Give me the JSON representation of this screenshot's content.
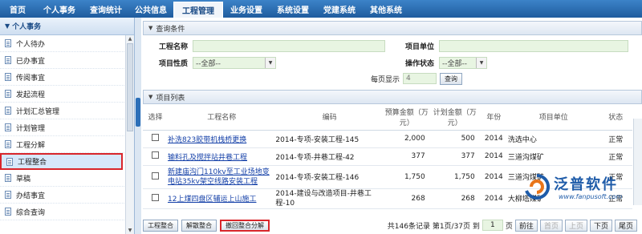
{
  "nav": {
    "items": [
      "首页",
      "个人事务",
      "查询统计",
      "公共信息",
      "工程管理",
      "业务设置",
      "系统设置",
      "党建系统",
      "其他系统"
    ],
    "active_index": 4
  },
  "sidebar": {
    "header": "个人事务",
    "items": [
      "个人待办",
      "已办事宜",
      "传阅事宜",
      "发起流程",
      "计划汇总管理",
      "计划管理",
      "工程分解",
      "工程整合",
      "草稿",
      "办结事宜",
      "综合查询"
    ],
    "selected_index": 7
  },
  "query": {
    "title": "查询条件",
    "project_name_label": "工程名称",
    "project_name_value": "",
    "project_unit_label": "项目单位",
    "project_unit_value": "",
    "project_type_label": "项目性质",
    "project_type_value": "--全部--",
    "op_status_label": "操作状态",
    "op_status_value": "--全部--",
    "per_page_label": "每页显示",
    "per_page_value": "4",
    "search_button": "查询"
  },
  "list": {
    "title": "项目列表",
    "columns": [
      "选择",
      "工程名称",
      "编码",
      "预算金额（万元）",
      "计划金额（万元）",
      "年份",
      "项目单位",
      "状态"
    ],
    "rows": [
      {
        "name": "补洗823胶带机栈桥更换",
        "code": "2014-专项-安装工程-145",
        "budget": "2,000",
        "plan": "500",
        "year": "2014",
        "unit": "洗选中心",
        "status": "正常"
      },
      {
        "name": "输料孔及搅拌站井巷工程",
        "code": "2014-专项-井巷工程-42",
        "budget": "377",
        "plan": "377",
        "year": "2014",
        "unit": "三道沟煤矿",
        "status": "正常"
      },
      {
        "name": "新建庙沟门110kv至工业场地变电站35kv架空线路安装工程",
        "code": "2014-专项-安装工程-146",
        "budget": "1,750",
        "plan": "1,750",
        "year": "2014",
        "unit": "三道沟煤矿",
        "status": "正常"
      },
      {
        "name": "12上煤四盘区辅运上山施工",
        "code": "2014-建设与改造项目-井巷工程-10",
        "budget": "268",
        "plan": "268",
        "year": "2014",
        "unit": "大柳塔煤矿",
        "status": "正常"
      }
    ]
  },
  "footer": {
    "merge_button": "工程整合",
    "unmerge_button": "解散整合",
    "revoke_button": "撤回整合分解",
    "pager_text": "共146条记录 第1页/37页 到",
    "page_input": "1",
    "pager_pg": "页",
    "prev": "前往",
    "first": "首页",
    "prev_page": "上页",
    "next_page": "下页",
    "last": "尾页"
  },
  "watermark": {
    "brand": "泛普软件",
    "url": "www.fanpusoft.com"
  }
}
